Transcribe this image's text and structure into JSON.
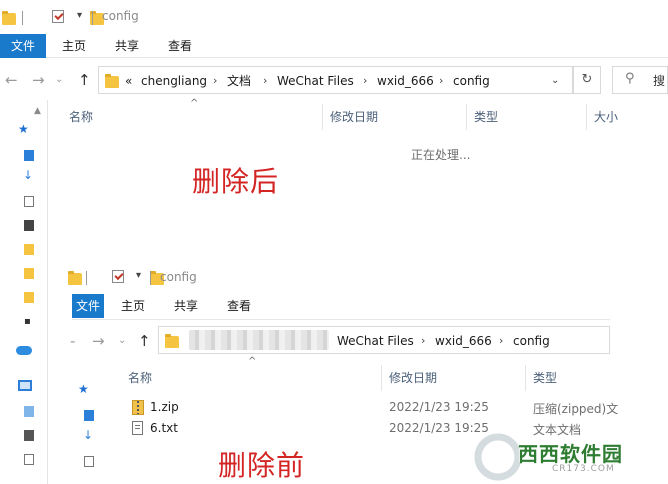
{
  "after": {
    "title": "config",
    "ribbon": {
      "file": "文件",
      "home": "主页",
      "share": "共享",
      "view": "查看"
    },
    "breadcrumb": {
      "overflow": "«",
      "items": [
        "chengliang",
        "文档",
        "WeChat Files",
        "wxid_666",
        "config"
      ]
    },
    "search_placeholder": "搜",
    "columns": {
      "name": "名称",
      "modified": "修改日期",
      "type": "类型",
      "size": "大小"
    },
    "status": "正在处理...",
    "label": "删除后"
  },
  "before": {
    "title": "config",
    "ribbon": {
      "file": "文件",
      "home": "主页",
      "share": "共享",
      "view": "查看"
    },
    "breadcrumb": {
      "items": [
        "WeChat Files",
        "wxid_666",
        "config"
      ]
    },
    "columns": {
      "name": "名称",
      "modified": "修改日期",
      "type": "类型"
    },
    "files": [
      {
        "name": "1.zip",
        "modified": "2022/1/23 19:25",
        "type": "压缩(zipped)文"
      },
      {
        "name": "6.txt",
        "modified": "2022/1/23 19:25",
        "type": "文本文档"
      }
    ],
    "label": "删除前"
  },
  "watermark": {
    "brand": "西西软件园",
    "url": "CR173.COM"
  },
  "colors": {
    "accent": "#1979ca",
    "label_red": "#d42525",
    "header_text": "#4c607a"
  }
}
